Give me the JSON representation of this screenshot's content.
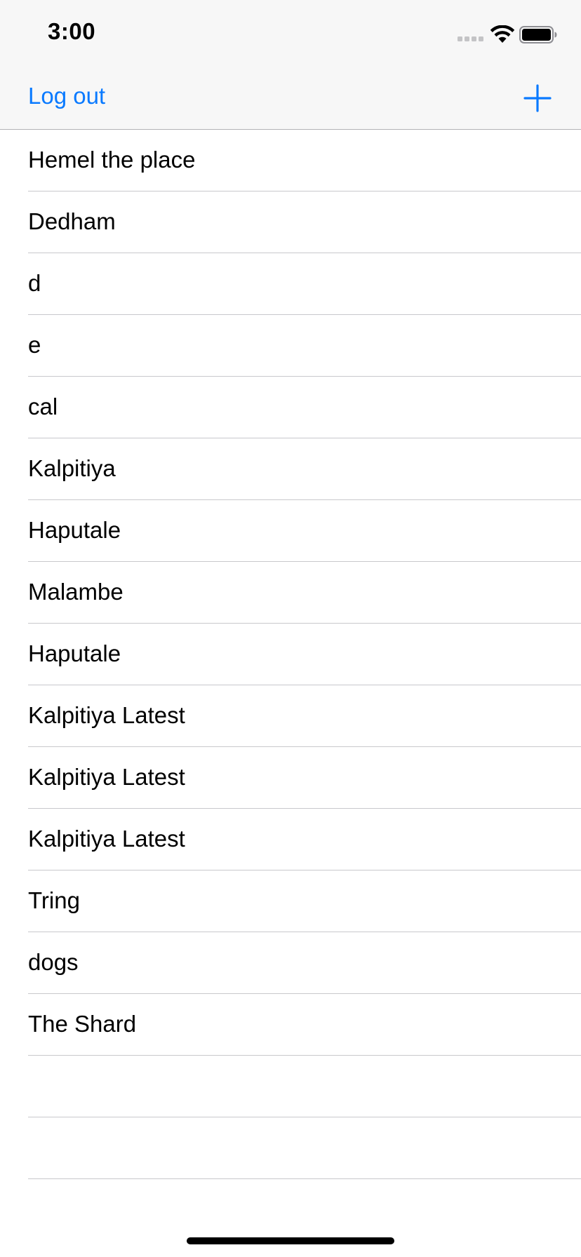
{
  "status_bar": {
    "time": "3:00"
  },
  "nav": {
    "logout_label": "Log out",
    "add_icon": "plus-icon",
    "accent_color": "#0a7aff"
  },
  "places": [
    {
      "label": "Hemel the place"
    },
    {
      "label": "Dedham"
    },
    {
      "label": "d"
    },
    {
      "label": "e"
    },
    {
      "label": "cal"
    },
    {
      "label": "Kalpitiya"
    },
    {
      "label": "Haputale"
    },
    {
      "label": "Malambe"
    },
    {
      "label": "Haputale"
    },
    {
      "label": "Kalpitiya Latest"
    },
    {
      "label": "Kalpitiya Latest"
    },
    {
      "label": "Kalpitiya Latest"
    },
    {
      "label": "Tring"
    },
    {
      "label": "dogs"
    },
    {
      "label": "The Shard"
    },
    {
      "label": ""
    },
    {
      "label": ""
    }
  ]
}
